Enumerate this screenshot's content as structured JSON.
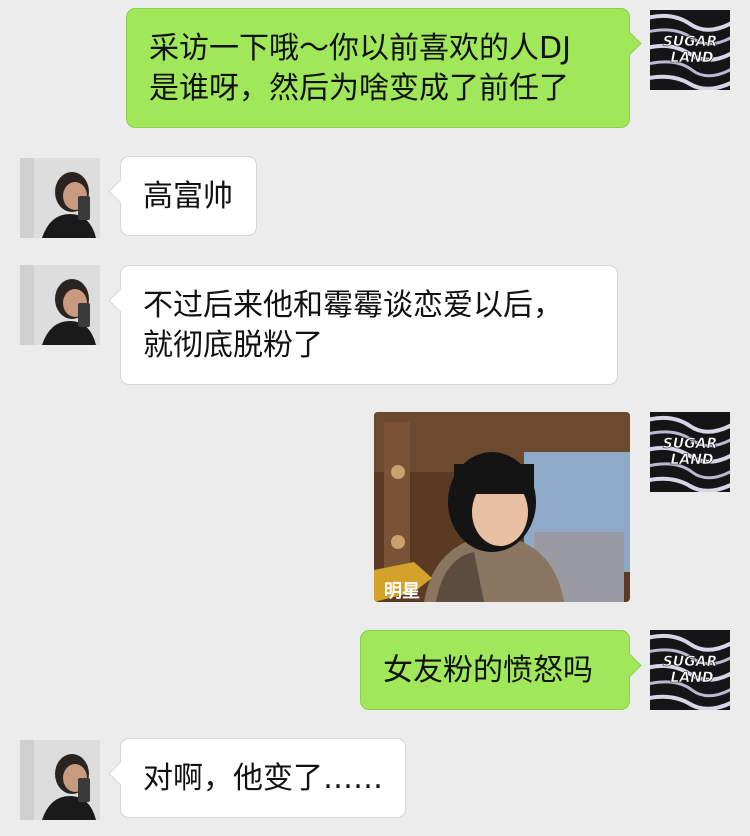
{
  "my_avatar": {
    "logo_line1": "SUGAR",
    "logo_line2": "LAND",
    "icon": "sugar-land-logo"
  },
  "contact_avatar": {
    "icon": "selfie-avatar"
  },
  "messages": [
    {
      "from": "me",
      "type": "text",
      "lines": [
        "采访一下哦～你以前喜欢的人DJ",
        "是谁呀，然后为啥变成了前任了"
      ]
    },
    {
      "from": "contact",
      "type": "text",
      "lines": [
        "高富帅"
      ]
    },
    {
      "from": "contact",
      "type": "text",
      "lines": [
        "不过后来他和霉霉谈恋爱以后，",
        "就彻底脱粉了"
      ]
    },
    {
      "from": "me",
      "type": "image",
      "caption": "明星",
      "icon": "tv-screenshot-image"
    },
    {
      "from": "me",
      "type": "text",
      "lines": [
        "女友粉的愤怒吗"
      ]
    },
    {
      "from": "contact",
      "type": "text",
      "lines": [
        "对啊，他变了……"
      ]
    }
  ]
}
